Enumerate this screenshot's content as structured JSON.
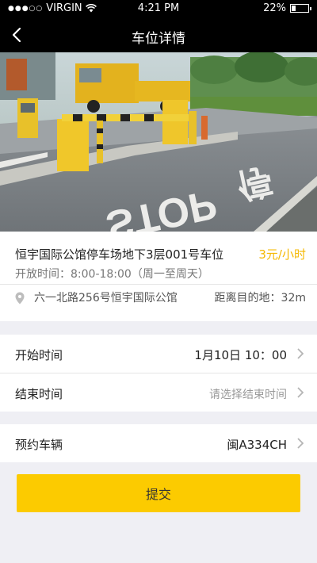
{
  "status_bar": {
    "signal_dots": "●●●○○",
    "carrier": "VIRGIN",
    "time": "4:21 PM",
    "battery_percent": "22%",
    "battery_level": 0.22
  },
  "nav": {
    "title": "车位详情",
    "back_icon": "chevron-left-icon"
  },
  "hero": {
    "road_text": "STOP 停"
  },
  "parking": {
    "name": "恒宇国际公馆停车场地下3层001号车位",
    "price": "3元/小时",
    "hours": "开放时间：8:00-18:00（周一至周天）",
    "address": "六一北路256号恒宇国际公馆",
    "distance": "距离目的地：32m"
  },
  "form": {
    "start_label": "开始时间",
    "start_value": "1月10日 10：00",
    "end_label": "结束时间",
    "end_placeholder": "请选择结束时间",
    "vehicle_label": "预约车辆",
    "vehicle_value": "闽A334CH"
  },
  "submit_label": "提交",
  "colors": {
    "accent": "#fccb00",
    "price": "#f5b800",
    "nav_bg": "#000000",
    "page_bg": "#efeff4"
  }
}
